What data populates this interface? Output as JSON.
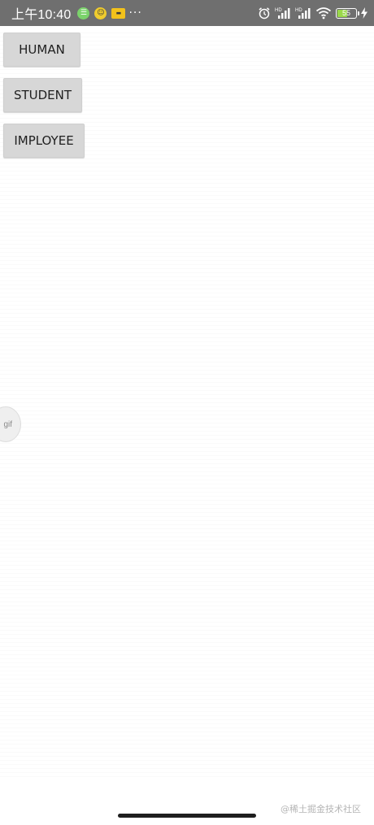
{
  "status_bar": {
    "time": "上午10:40",
    "notifications": [
      {
        "icon": "message-icon",
        "glyph": "☰",
        "color": "#7bd36b"
      },
      {
        "icon": "emoji-app-icon",
        "glyph": "☺",
        "color": "#f0cc2e"
      },
      {
        "icon": "tag-app-icon",
        "glyph": "▬",
        "color": "#f3c21b"
      }
    ],
    "more": "···",
    "system_icons": [
      "alarm-icon",
      "signal-hd-icon",
      "signal-hd-icon",
      "wifi-icon",
      "battery-icon",
      "charging-icon"
    ],
    "battery_level": "55",
    "battery_fraction": 0.55
  },
  "buttons": {
    "human": "HUMAN",
    "student": "STUDENT",
    "employee": "IMPLOYEE"
  },
  "floating_bubble": {
    "label": "gif"
  },
  "watermark": "@稀土掘金技术社区"
}
